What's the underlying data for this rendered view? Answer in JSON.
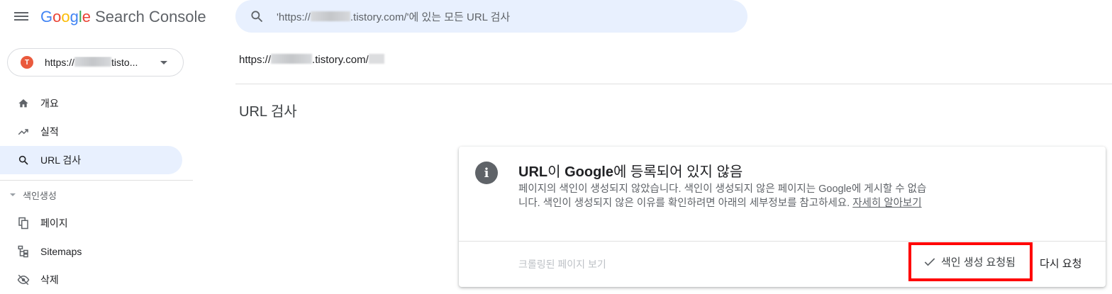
{
  "app": {
    "title_parts": [
      "G",
      "o",
      "o",
      "g",
      "l",
      "e"
    ],
    "title_suffix": " Search Console"
  },
  "search": {
    "prefix": "'https://",
    "suffix": ".tistory.com/'에 있는 모든 URL 검사"
  },
  "property": {
    "prefix": "https://",
    "suffix": "tisto...",
    "icon_letter": "T"
  },
  "sidebar": {
    "items": [
      {
        "label": "개요",
        "icon": "home-icon"
      },
      {
        "label": "실적",
        "icon": "trending-up-icon"
      },
      {
        "label": "URL 검사",
        "icon": "search-icon",
        "active": true
      }
    ],
    "section": "색인생성",
    "section_items": [
      {
        "label": "페이지",
        "icon": "pages-icon"
      },
      {
        "label": "Sitemaps",
        "icon": "sitemap-icon"
      },
      {
        "label": "삭제",
        "icon": "visibility-off-icon"
      }
    ]
  },
  "main": {
    "url_prefix": "https://",
    "url_suffix": ".tistory.com/",
    "page_title": "URL 검사"
  },
  "card": {
    "title_url": "URL",
    "title_mid": "이 ",
    "title_google": "Google",
    "title_rest": "에 등록되어 있지 않음",
    "desc": "페이지의 색인이 생성되지 않았습니다. 색인이 생성되지 않은 페이지는 Google에 게시할 수 없습니다. 색인이 생성되지 않은 이유를 확인하려면 아래의 세부정보를 참고하세요. ",
    "learn_more": "자세히 알아보기",
    "crawled_page": "크롤링된 페이지 보기",
    "requested": "색인 생성 요청됨",
    "retry": "다시 요청"
  },
  "colors": {
    "accent": "#1a73e8",
    "active_bg": "#e8f0fe",
    "highlight": "#ff0000"
  }
}
